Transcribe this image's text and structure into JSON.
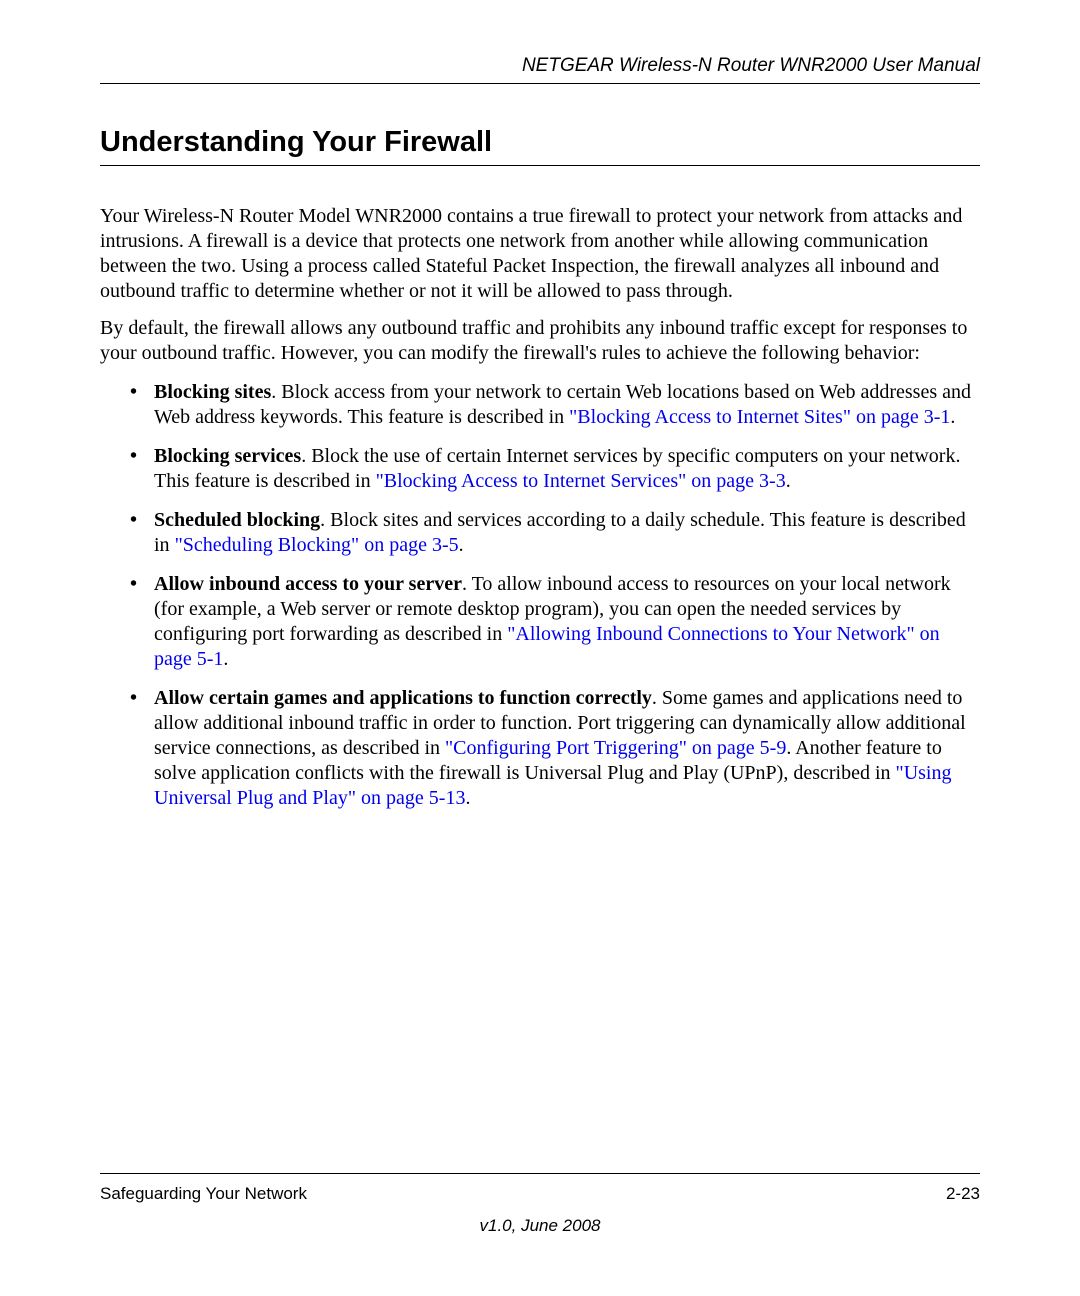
{
  "header": {
    "doc_title": "NETGEAR Wireless-N Router WNR2000 User Manual"
  },
  "heading": "Understanding Your Firewall",
  "para1": "Your Wireless-N Router Model WNR2000 contains a true firewall to protect your network from attacks and intrusions. A firewall is a device that protects one network from another while allowing communication between the two. Using a process called Stateful Packet Inspection, the firewall analyzes all inbound and outbound traffic to determine whether or not it will be allowed to pass through.",
  "para2": "By default, the firewall allows any outbound traffic and prohibits any inbound traffic except for responses to your outbound traffic. However, you can modify the firewall's rules to achieve the following behavior:",
  "bullets": {
    "b1_bold": "Blocking sites",
    "b1_text": ". Block access from your network to certain Web locations based on Web addresses and Web address keywords. This feature is described in ",
    "b1_link": "\"Blocking Access to Internet Sites\" on page 3-1",
    "b1_tail": ".",
    "b2_bold": "Blocking services",
    "b2_text": ". Block the use of certain Internet services by specific computers on your network. This feature is described in ",
    "b2_link": "\"Blocking Access to Internet Services\" on page 3-3",
    "b2_tail": ".",
    "b3_bold": "Scheduled blocking",
    "b3_text": ". Block sites and services according to a daily schedule. This feature is described in ",
    "b3_link": "\"Scheduling Blocking\" on page 3-5",
    "b3_tail": ".",
    "b4_bold": "Allow inbound access to your server",
    "b4_text": ". To allow inbound access to resources on your local network (for example, a Web server or remote desktop program), you can open the needed services by configuring port forwarding as described in ",
    "b4_link": "\"Allowing Inbound Connections to Your Network\" on page 5-1",
    "b4_tail": ".",
    "b5_bold": "Allow certain games and applications to function correctly",
    "b5_text": ". Some games and applications need to allow additional inbound traffic in order to function. Port triggering can dynamically allow additional service connections, as described in ",
    "b5_link": "\"Configuring Port Triggering\" on page 5-9",
    "b5_mid": ". Another feature to solve application conflicts with the firewall is Universal Plug and Play (UPnP), described in ",
    "b5_link2": "\"Using Universal Plug and Play\" on page 5-13",
    "b5_tail": "."
  },
  "footer": {
    "section": "Safeguarding Your Network",
    "page": "2-23",
    "version": "v1.0, June 2008"
  }
}
